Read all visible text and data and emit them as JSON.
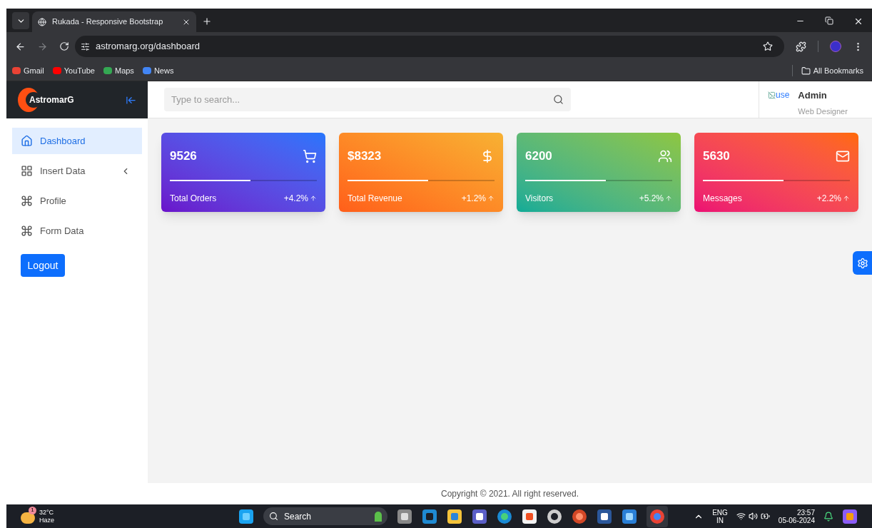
{
  "browser": {
    "tab_title": "Rukada - Responsive Bootstrap",
    "url": "astromarg.org/dashboard",
    "bookmarks": [
      {
        "label": "Gmail",
        "kind": "gmail"
      },
      {
        "label": "YouTube",
        "kind": "youtube"
      },
      {
        "label": "Maps",
        "kind": "maps"
      },
      {
        "label": "News",
        "kind": "news"
      }
    ],
    "all_bookmarks": "All Bookmarks"
  },
  "brand": "AstromarG",
  "search": {
    "placeholder": "Type to search..."
  },
  "user": {
    "avatar_alt": "use",
    "name": "Admin",
    "role": "Web Designer"
  },
  "sidebar": {
    "items": [
      {
        "label": "Dashboard",
        "kind": "home",
        "selected": true,
        "expandable": false
      },
      {
        "label": "Insert Data",
        "kind": "grid",
        "selected": false,
        "expandable": true
      },
      {
        "label": "Profile",
        "kind": "command",
        "selected": false,
        "expandable": false
      },
      {
        "label": "Form Data",
        "kind": "command",
        "selected": false,
        "expandable": false
      }
    ],
    "logout": "Logout"
  },
  "cards": [
    {
      "value": "9526",
      "label": "Total Orders",
      "change": "+4.2%",
      "kind": "orders",
      "level": 0.55
    },
    {
      "value": "$8323",
      "label": "Total Revenue",
      "change": "+1.2%",
      "kind": "revenue",
      "level": 0.55
    },
    {
      "value": "6200",
      "label": "Visitors",
      "change": "+5.2%",
      "kind": "visitors",
      "level": 0.55
    },
    {
      "value": "5630",
      "label": "Messages",
      "change": "+2.2%",
      "kind": "messages",
      "level": 0.55
    }
  ],
  "footer": "Copyright © 2021. All right reserved.",
  "taskbar": {
    "weather_badge": "1",
    "temperature": "32°C",
    "weather": "Haze",
    "search": "Search",
    "language": "ENG",
    "region": "IN",
    "time": "23:57",
    "date": "05-06-2024"
  }
}
